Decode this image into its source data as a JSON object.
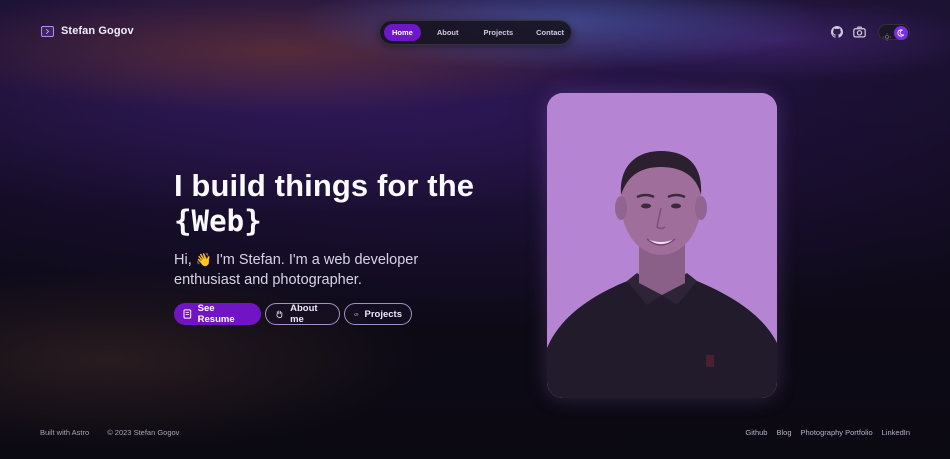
{
  "brand": {
    "name": "Stefan Gogov",
    "icon": "terminal-icon"
  },
  "nav": {
    "items": [
      {
        "label": "Home",
        "active": true
      },
      {
        "label": "About",
        "active": false
      },
      {
        "label": "Projects",
        "active": false
      },
      {
        "label": "Contact",
        "active": false
      }
    ]
  },
  "header_icons": [
    "github-icon",
    "camera-icon",
    "sun-icon",
    "moon-icon"
  ],
  "hero": {
    "title_line1": "I build things for the",
    "title_line2": "{Web}",
    "intro_prefix": "Hi,",
    "wave_emoji": "👋",
    "intro_text": "I'm Stefan. I'm a web developer enthusiast and photographer."
  },
  "buttons": {
    "resume": "See Resume",
    "about": "About me",
    "projects": "Projects"
  },
  "footer": {
    "built_with": "Built with Astro",
    "copyright": "© 2023 Stefan Gogov",
    "links": [
      "Github",
      "Blog",
      "Photography Portfolio",
      "LinkedIn"
    ]
  },
  "colors": {
    "accent": "#6d17c9",
    "background": "#0d0a15",
    "portrait_tint": "#b585d3"
  }
}
